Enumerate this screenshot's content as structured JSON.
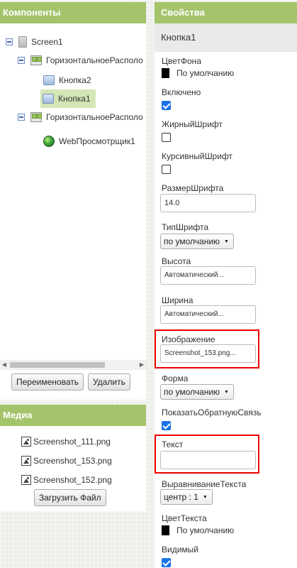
{
  "components": {
    "title": "Компоненты",
    "tree": [
      {
        "label": "Screen1",
        "icon": "screen-icon"
      },
      {
        "label": "ГоризонтальноеРасполо",
        "icon": "horizontal-arrangement-icon"
      },
      {
        "label": "Кнопка2",
        "icon": "button-icon"
      },
      {
        "label": "Кнопка1",
        "icon": "button-icon",
        "selected": true
      },
      {
        "label": "ГоризонтальноеРасполо",
        "icon": "horizontal-arrangement-icon"
      },
      {
        "label": "WebПросмотрщик1",
        "icon": "webviewer-icon"
      }
    ],
    "rename_label": "Переименовать",
    "delete_label": "Удалить"
  },
  "media": {
    "title": "Медиа",
    "files": [
      "Screenshot_111.png",
      "Screenshot_153.png",
      "Screenshot_152.png"
    ],
    "upload_label": "Загрузить Файл"
  },
  "properties": {
    "title": "Свойства",
    "component_name": "Кнопка1",
    "background_color": {
      "label": "ЦветФона",
      "value": "По умолчанию",
      "swatch": "#000000"
    },
    "enabled": {
      "label": "Включено",
      "checked": true
    },
    "font_bold": {
      "label": "ЖирныйШрифт",
      "checked": false
    },
    "font_italic": {
      "label": "КурсивныйШрифт",
      "checked": false
    },
    "font_size": {
      "label": "РазмерШрифта",
      "value": "14.0"
    },
    "font_typeface": {
      "label": "ТипШрифта",
      "value": "по умолчанию"
    },
    "height": {
      "label": "Высота",
      "value": "Автоматический..."
    },
    "width": {
      "label": "Ширина",
      "value": "Автоматический..."
    },
    "image": {
      "label": "Изображение",
      "value": "Screenshot_153.png..."
    },
    "shape": {
      "label": "Форма",
      "value": "по умолчанию"
    },
    "show_feedback": {
      "label": "ПоказатьОбратнуюСвязь",
      "checked": true
    },
    "text": {
      "label": "Текст",
      "value": ""
    },
    "text_alignment": {
      "label": "ВыравниваниеТекста",
      "value": "центр : 1"
    },
    "text_color": {
      "label": "ЦветТекста",
      "value": "По умолчанию",
      "swatch": "#000000"
    },
    "visible": {
      "label": "Видимый",
      "checked": true
    }
  },
  "colors": {
    "header_green": "#a4c46b",
    "selection_green": "#d5e6b6",
    "highlight_red": "#e00000",
    "checkbox_blue": "#1a73e8"
  }
}
